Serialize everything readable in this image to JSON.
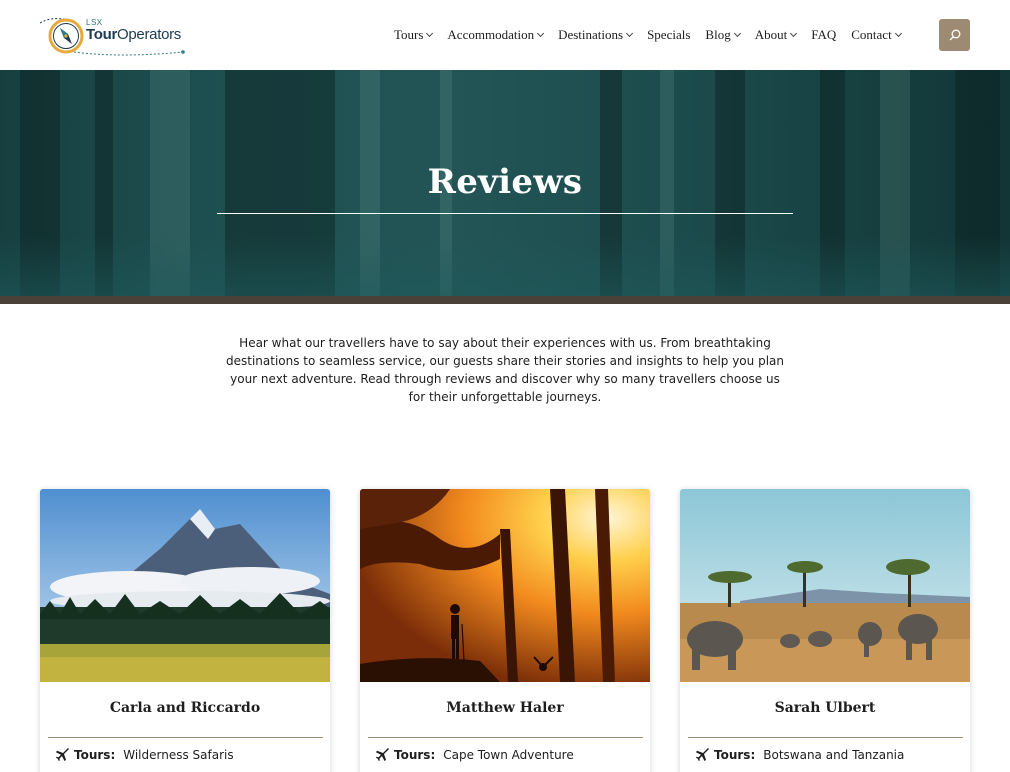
{
  "brand": {
    "logo_small": "LSX",
    "logo_name_bold": "Tour",
    "logo_name_light": "Operators"
  },
  "nav": {
    "items": [
      {
        "label": "Tours",
        "has_dropdown": true
      },
      {
        "label": "Accommodation",
        "has_dropdown": true
      },
      {
        "label": "Destinations",
        "has_dropdown": true
      },
      {
        "label": "Specials",
        "has_dropdown": false
      },
      {
        "label": "Blog",
        "has_dropdown": true
      },
      {
        "label": "About",
        "has_dropdown": true
      },
      {
        "label": "FAQ",
        "has_dropdown": false
      },
      {
        "label": "Contact",
        "has_dropdown": true
      }
    ],
    "search_icon": "search-icon"
  },
  "hero": {
    "title": "Reviews"
  },
  "intro": {
    "text": "Hear what our travellers have to say about their experiences with us. From breathtaking destinations to seamless service, our guests share their stories and insights to help you plan your next adventure. Read through reviews and discover why so many travellers choose us for their unforgettable journeys."
  },
  "cards": [
    {
      "name": "Carla and Riccardo",
      "tours_label": "Tours:",
      "tours_value": "Wilderness Safaris",
      "image": "mountain-landscape"
    },
    {
      "name": "Matthew Haler",
      "tours_label": "Tours:",
      "tours_value": "Cape Town Adventure",
      "image": "hiker-sunset"
    },
    {
      "name": "Sarah Ulbert",
      "tours_label": "Tours:",
      "tours_value": "Botswana and Tanzania",
      "image": "elephants-savanna"
    }
  ],
  "colors": {
    "accent": "#9d8a72",
    "hero_teal": "#1e4f50",
    "divider": "#a08a72",
    "hero_strip": "#4a4238"
  }
}
